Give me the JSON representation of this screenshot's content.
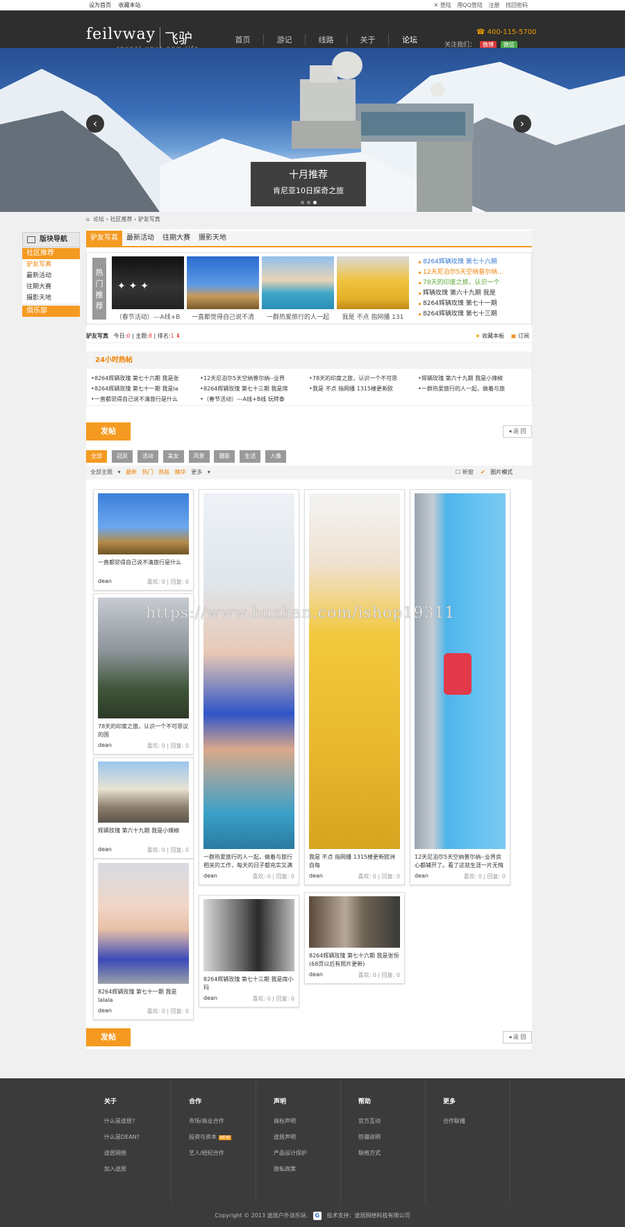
{
  "topbar": {
    "set_home": "设为首页",
    "bookmark": "收藏本站",
    "login": "登陆",
    "qq_login": "用QQ登陆",
    "register": "注册",
    "forgot": "找回密码"
  },
  "logo": {
    "en": "feilvway",
    "cn": "飞驴湾",
    "tagline": "reveal your new life"
  },
  "nav": [
    "首页",
    "游记",
    "线路",
    "关于",
    "论坛"
  ],
  "header": {
    "phone": "400-115-5700",
    "follow": "关注我们：",
    "weibo": "微博",
    "wechat": "微信"
  },
  "banner": {
    "title": "十月推荐",
    "subtitle": "肯尼亚10日探奇之旅"
  },
  "breadcrumb": [
    "论坛",
    "社区推荐",
    "驴友写真"
  ],
  "sidebar": {
    "title": "版块导航",
    "cat1": "社区推荐",
    "items": [
      "驴友写真",
      "最新活动",
      "往期大赛",
      "摄影天地"
    ],
    "cat2": "俱乐部"
  },
  "tabs": [
    "驴友写真",
    "最新活动",
    "往期大赛",
    "摄影天地"
  ],
  "hot": {
    "label": "热门推荐",
    "photos": [
      "（春节活动）---A线+B",
      "一直都觉得自己说不清",
      "一群热爱旅行的人一起",
      "我是 不点 指网播 131"
    ],
    "list": [
      "8264辉辆玫瑰 第七十六期",
      "12天尼泊尔5天空纳普尔纳...",
      "78天的印度之旅，认识一个",
      "辉辆玫瑰 第六十九期 我是",
      "8264辉辆玫瑰 第七十一期",
      "8264辉辆玫瑰 第七十三期"
    ],
    "colors": [
      "#3a7bd5",
      "#f08000",
      "#5aa832",
      "#333333",
      "#333333",
      "#333333"
    ]
  },
  "stats": {
    "name": "驴友写真",
    "today_label": "今日:",
    "today": "0",
    "topics_label": "主题:",
    "topics": "8",
    "rank_label": "排名:",
    "rank": "1",
    "fav": "收藏本板",
    "rss": "订阅"
  },
  "hot24": {
    "title": "24小时热帖",
    "items": [
      "8264辉辆玫瑰 第七十六期 我是张",
      "12天尼泊尔5天空纳普尔纳--业界",
      "78天的印度之旅，认识一个不可思",
      "辉辆玫瑰 第六十九期 我是小辣椒",
      "8264辉辆玫瑰 第七十一期 我是la",
      "8264辉辆玫瑰 第七十三期 我是席",
      "我是 不点 指网播 1315楼更新欧",
      "一群热爱旅行的人一起，做着与旅",
      "一直都觉得自己说不清旅行是什么",
      "（春节活动）---A线+B线 玩转泰"
    ]
  },
  "buttons": {
    "post": "发帖",
    "back": "返 回"
  },
  "filters": [
    "全部",
    "冠吴",
    "活动",
    "美女",
    "风景",
    "摄影",
    "生活",
    "人像"
  ],
  "sortbar": {
    "all": "全部主题",
    "latest": "最新",
    "hot": "热门",
    "hot_post": "热帖",
    "digest": "精华",
    "more": "更多",
    "new_window": "新窗",
    "image_mode": "图片模式"
  },
  "cards": [
    {
      "title": "一直都觉得自己说不清旅行是什么",
      "author": "dean",
      "likes": "喜欢: 0",
      "replies": "回复: 0"
    },
    {
      "title": "78天的印度之旅，认识一个不可思议的国",
      "author": "dean",
      "likes": "喜欢: 0",
      "replies": "回复: 0"
    },
    {
      "title": "辉辆玫瑰 第六十九期 我是小辣椒",
      "author": "dean",
      "likes": "喜欢: 0",
      "replies": "回复: 0"
    },
    {
      "title": "8264辉辆玫瑰 第七十一期 我是lalala",
      "author": "dean",
      "likes": "喜欢: 0",
      "replies": "回复: 0"
    },
    {
      "title": "一群热爱旅行的人一起，做着与旅行相关的工作，每天的日子都充实又满足",
      "author": "dean",
      "likes": "喜欢: 0",
      "replies": "回复: 0"
    },
    {
      "title": "8264辉辆玫瑰 第七十三期 我是席小玛",
      "author": "dean",
      "likes": "喜欢: 0",
      "replies": "回复: 0"
    },
    {
      "title": "我是 不点 指网播 1315楼更新欧洲自每",
      "author": "dean",
      "likes": "喜欢: 0",
      "replies": "回复: 0"
    },
    {
      "title": "8264辉辆玫瑰 第七十六期 我是张恒(68页以后有照片更新)",
      "author": "dean",
      "likes": "喜欢: 0",
      "replies": "回复: 0"
    },
    {
      "title": "12天尼泊尔5天空纳普尔纳--业界良心都辅开了。看了这就生涯一片无悔",
      "author": "dean",
      "likes": "喜欢: 0",
      "replies": "回复: 0"
    }
  ],
  "watermark": "https://www.huzhan.com/ishop19311",
  "footer": {
    "cols": [
      {
        "h": "关于",
        "items": [
          "什么是途居?",
          "什么是DEAN?",
          "途居网络",
          "加入途居"
        ]
      },
      {
        "h": "合作",
        "items": [
          "市场/商业合作",
          "投资与资本",
          "艺人/经纪合作"
        ]
      },
      {
        "h": "声明",
        "items": [
          "商标声明",
          "途居声明",
          "产品设计保护",
          "隐私政策"
        ]
      },
      {
        "h": "帮助",
        "items": [
          "官方互动",
          "防骗说明",
          "联络方式"
        ]
      },
      {
        "h": "更多",
        "items": [
          "合作联播"
        ]
      }
    ],
    "badge": "NEW",
    "copyright": "Copyright © 2013 途居户外派乐站.",
    "support": "技术支持：途居网络科技有限公司"
  }
}
